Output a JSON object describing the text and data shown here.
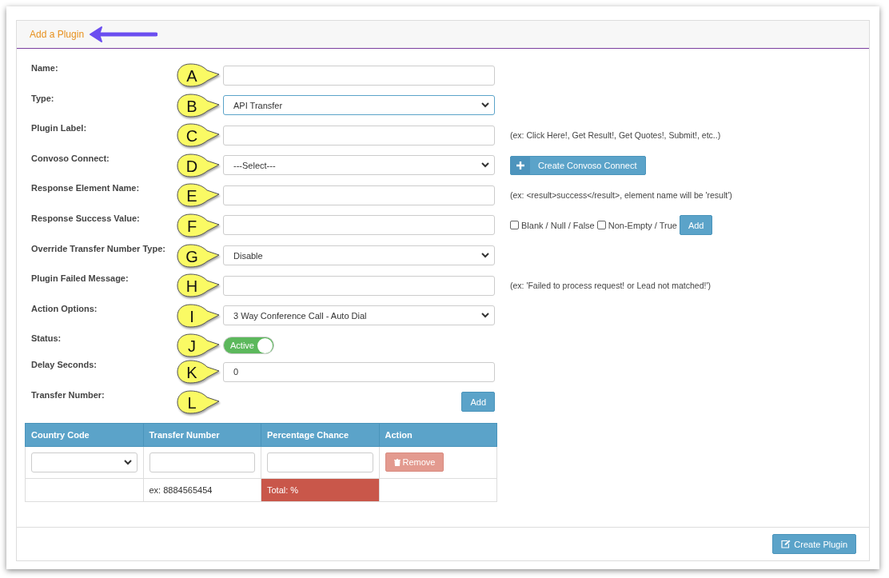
{
  "panel": {
    "title": "Add a Plugin"
  },
  "fields": [
    {
      "label": "Name:",
      "marker": "A",
      "kind": "input",
      "focused": false
    },
    {
      "label": "Type:",
      "marker": "B",
      "kind": "select",
      "value": "API Transfer",
      "focused": true
    },
    {
      "label": "Plugin Label:",
      "marker": "C",
      "kind": "input",
      "focused": false,
      "note": "(ex: Click Here!, Get Result!, Get Quotes!, Submit!, etc..)"
    },
    {
      "label": "Convoso Connect:",
      "marker": "D",
      "kind": "select",
      "value": "---Select---",
      "focused": false,
      "action": "Create Convoso Connect"
    },
    {
      "label": "Response Element Name:",
      "marker": "E",
      "kind": "input",
      "focused": false,
      "note": "(ex: <result>success</result>, element name will be 'result')"
    },
    {
      "label": "Response Success Value:",
      "marker": "F",
      "kind": "input",
      "focused": false,
      "options": [
        {
          "label": "Blank / Null / False",
          "checked": false
        },
        {
          "label": "Non-Empty / True",
          "checked": false
        }
      ],
      "add_button": "Add"
    },
    {
      "label": "Override Transfer Number Type:",
      "marker": "G",
      "kind": "select",
      "value": "Disable",
      "focused": false
    },
    {
      "label": "Plugin Failed Message:",
      "marker": "H",
      "kind": "input",
      "focused": false,
      "note": "(ex: 'Failed to process request! or Lead not matched!')"
    },
    {
      "label": "Action Options:",
      "marker": "I",
      "kind": "select",
      "value": "3 Way Conference Call - Auto Dial",
      "focused": false
    },
    {
      "label": "Status:",
      "marker": "J",
      "kind": "toggle",
      "toggle_label": "Active",
      "on": true
    },
    {
      "label": "Delay Seconds:",
      "marker": "K",
      "kind": "input",
      "value": "0",
      "focused": false
    },
    {
      "label": "Transfer Number:",
      "marker": "L",
      "kind": "button",
      "button": "Add"
    }
  ],
  "table": {
    "columns": [
      "Country Code",
      "Transfer Number",
      "Percentage Chance",
      "Action"
    ],
    "rows": [
      [
        {
          "kind": "select"
        },
        {
          "kind": "input"
        },
        {
          "kind": "input"
        },
        {
          "kind": "remove",
          "text": "Remove"
        }
      ],
      [
        {
          "kind": "empty"
        },
        {
          "kind": "text",
          "text": "ex: 8884565454"
        },
        {
          "kind": "total",
          "text": "Total: %"
        },
        {
          "kind": "empty"
        }
      ]
    ]
  },
  "footer": {
    "button": "Create Plugin"
  }
}
